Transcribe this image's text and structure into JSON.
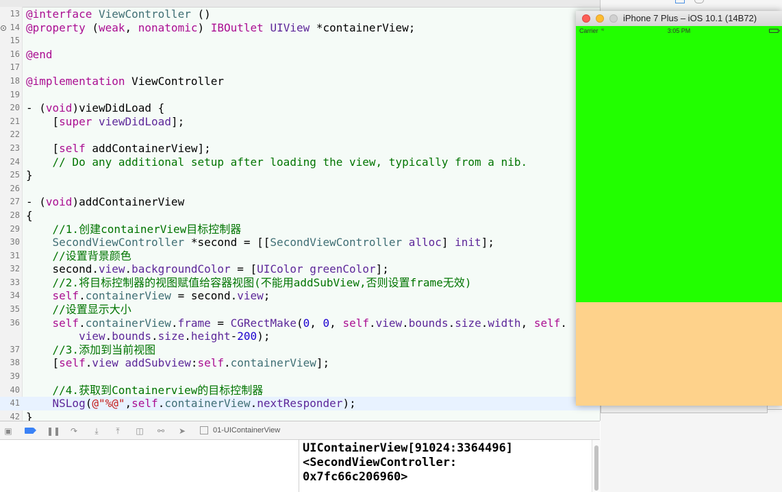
{
  "editor": {
    "lines": [
      {
        "num": "13",
        "html": "<span class=\"k\">@interface</span> <span class=\"t\">ViewController</span> ()"
      },
      {
        "num": "14",
        "breakpoint": true,
        "html": "<span class=\"k\">@property</span> (<span class=\"k\">weak</span>, <span class=\"k\">nonatomic</span>) <span class=\"k\">IBOutlet</span> <span class=\"p\">UIView</span> *containerView;"
      },
      {
        "num": "15",
        "html": ""
      },
      {
        "num": "16",
        "html": "<span class=\"k\">@end</span>"
      },
      {
        "num": "17",
        "html": ""
      },
      {
        "num": "18",
        "html": "<span class=\"k\">@implementation</span> ViewController"
      },
      {
        "num": "19",
        "html": ""
      },
      {
        "num": "20",
        "html": "- (<span class=\"k\">void</span>)viewDidLoad {"
      },
      {
        "num": "21",
        "html": "    [<span class=\"k\">super</span> <span class=\"p\">viewDidLoad</span>];"
      },
      {
        "num": "22",
        "html": ""
      },
      {
        "num": "23",
        "html": "    [<span class=\"k\">self</span> addContainerView];"
      },
      {
        "num": "24",
        "html": "    <span class=\"c\">// Do any additional setup after loading the view, typically from a nib.</span>"
      },
      {
        "num": "25",
        "html": "}"
      },
      {
        "num": "26",
        "html": ""
      },
      {
        "num": "27",
        "html": "- (<span class=\"k\">void</span>)addContainerView"
      },
      {
        "num": "28",
        "html": "{"
      },
      {
        "num": "29",
        "html": "    <span class=\"c\">//1.创建containerView目标控制器</span>"
      },
      {
        "num": "30",
        "html": "    <span class=\"t\">SecondViewController</span> *second = [[<span class=\"t\">SecondViewController</span> <span class=\"p\">alloc</span>] <span class=\"p\">init</span>];"
      },
      {
        "num": "31",
        "html": "    <span class=\"c\">//设置背景颜色</span>"
      },
      {
        "num": "32",
        "html": "    second.<span class=\"p\">view</span>.<span class=\"p\">backgroundColor</span> = [<span class=\"p\">UIColor</span> <span class=\"p\">greenColor</span>];"
      },
      {
        "num": "33",
        "html": "    <span class=\"c\">//2.将目标控制器的视图赋值给容器视图(不能用addSubView,否则设置frame无效)</span>"
      },
      {
        "num": "34",
        "html": "    <span class=\"k\">self</span>.<span class=\"t\">containerView</span> = second.<span class=\"p\">view</span>;"
      },
      {
        "num": "35",
        "html": "    <span class=\"c\">//设置显示大小</span>"
      },
      {
        "num": "36",
        "html": "    <span class=\"k\">self</span>.<span class=\"t\">containerView</span>.<span class=\"p\">frame</span> = <span class=\"p\">CGRectMake</span>(<span class=\"m\">0</span>, <span class=\"m\">0</span>, <span class=\"k\">self</span>.<span class=\"p\">view</span>.<span class=\"p\">bounds</span>.<span class=\"p\">size</span>.<span class=\"p\">width</span>, <span class=\"k\">self</span>."
      },
      {
        "num": "",
        "html": "        <span class=\"p\">view</span>.<span class=\"p\">bounds</span>.<span class=\"p\">size</span>.<span class=\"p\">height</span>-<span class=\"m\">200</span>);"
      },
      {
        "num": "37",
        "html": "    <span class=\"c\">//3.添加到当前视图</span>"
      },
      {
        "num": "38",
        "html": "    [<span class=\"k\">self</span>.<span class=\"p\">view</span> <span class=\"p\">addSubview</span>:<span class=\"k\">self</span>.<span class=\"t\">containerView</span>];"
      },
      {
        "num": "39",
        "html": ""
      },
      {
        "num": "40",
        "html": "    <span class=\"c\">//4.获取到Containerview的目标控制器</span>"
      },
      {
        "num": "41",
        "current": true,
        "html": "    <span class=\"p\">NSLog</span>(<span class=\"s\">@\"%@\"</span>,<span class=\"k\">self</span>.<span class=\"t\">containerView</span>.<span class=\"p\">nextResponder</span>);"
      },
      {
        "num": "42",
        "html": "}"
      }
    ]
  },
  "debugbar": {
    "target_label": "01-UIContainerView"
  },
  "console": {
    "text": "UIContainerView[91024:3364496]\n<SecondViewController:\n0x7fc66c206960>"
  },
  "simulator": {
    "title": "iPhone 7 Plus – iOS 10.1 (14B72)",
    "carrier": "Carrier",
    "wifi_icon": "wifi-icon",
    "time": "3:05 PM",
    "green_color": "#22ff00",
    "bottom_color": "#fed28b"
  }
}
